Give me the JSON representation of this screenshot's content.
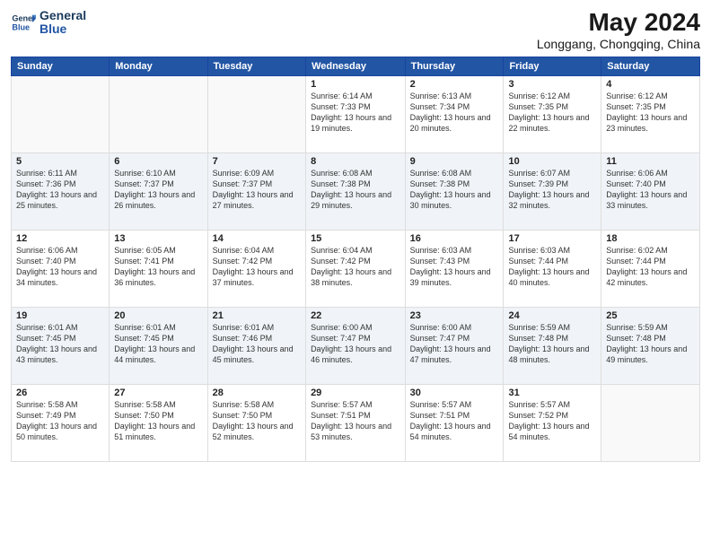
{
  "header": {
    "logo_line1": "General",
    "logo_line2": "Blue",
    "title": "May 2024",
    "subtitle": "Longgang, Chongqing, China"
  },
  "weekdays": [
    "Sunday",
    "Monday",
    "Tuesday",
    "Wednesday",
    "Thursday",
    "Friday",
    "Saturday"
  ],
  "weeks": [
    [
      {
        "day": "",
        "info": ""
      },
      {
        "day": "",
        "info": ""
      },
      {
        "day": "",
        "info": ""
      },
      {
        "day": "1",
        "info": "Sunrise: 6:14 AM\nSunset: 7:33 PM\nDaylight: 13 hours\nand 19 minutes."
      },
      {
        "day": "2",
        "info": "Sunrise: 6:13 AM\nSunset: 7:34 PM\nDaylight: 13 hours\nand 20 minutes."
      },
      {
        "day": "3",
        "info": "Sunrise: 6:12 AM\nSunset: 7:35 PM\nDaylight: 13 hours\nand 22 minutes."
      },
      {
        "day": "4",
        "info": "Sunrise: 6:12 AM\nSunset: 7:35 PM\nDaylight: 13 hours\nand 23 minutes."
      }
    ],
    [
      {
        "day": "5",
        "info": "Sunrise: 6:11 AM\nSunset: 7:36 PM\nDaylight: 13 hours\nand 25 minutes."
      },
      {
        "day": "6",
        "info": "Sunrise: 6:10 AM\nSunset: 7:37 PM\nDaylight: 13 hours\nand 26 minutes."
      },
      {
        "day": "7",
        "info": "Sunrise: 6:09 AM\nSunset: 7:37 PM\nDaylight: 13 hours\nand 27 minutes."
      },
      {
        "day": "8",
        "info": "Sunrise: 6:08 AM\nSunset: 7:38 PM\nDaylight: 13 hours\nand 29 minutes."
      },
      {
        "day": "9",
        "info": "Sunrise: 6:08 AM\nSunset: 7:38 PM\nDaylight: 13 hours\nand 30 minutes."
      },
      {
        "day": "10",
        "info": "Sunrise: 6:07 AM\nSunset: 7:39 PM\nDaylight: 13 hours\nand 32 minutes."
      },
      {
        "day": "11",
        "info": "Sunrise: 6:06 AM\nSunset: 7:40 PM\nDaylight: 13 hours\nand 33 minutes."
      }
    ],
    [
      {
        "day": "12",
        "info": "Sunrise: 6:06 AM\nSunset: 7:40 PM\nDaylight: 13 hours\nand 34 minutes."
      },
      {
        "day": "13",
        "info": "Sunrise: 6:05 AM\nSunset: 7:41 PM\nDaylight: 13 hours\nand 36 minutes."
      },
      {
        "day": "14",
        "info": "Sunrise: 6:04 AM\nSunset: 7:42 PM\nDaylight: 13 hours\nand 37 minutes."
      },
      {
        "day": "15",
        "info": "Sunrise: 6:04 AM\nSunset: 7:42 PM\nDaylight: 13 hours\nand 38 minutes."
      },
      {
        "day": "16",
        "info": "Sunrise: 6:03 AM\nSunset: 7:43 PM\nDaylight: 13 hours\nand 39 minutes."
      },
      {
        "day": "17",
        "info": "Sunrise: 6:03 AM\nSunset: 7:44 PM\nDaylight: 13 hours\nand 40 minutes."
      },
      {
        "day": "18",
        "info": "Sunrise: 6:02 AM\nSunset: 7:44 PM\nDaylight: 13 hours\nand 42 minutes."
      }
    ],
    [
      {
        "day": "19",
        "info": "Sunrise: 6:01 AM\nSunset: 7:45 PM\nDaylight: 13 hours\nand 43 minutes."
      },
      {
        "day": "20",
        "info": "Sunrise: 6:01 AM\nSunset: 7:45 PM\nDaylight: 13 hours\nand 44 minutes."
      },
      {
        "day": "21",
        "info": "Sunrise: 6:01 AM\nSunset: 7:46 PM\nDaylight: 13 hours\nand 45 minutes."
      },
      {
        "day": "22",
        "info": "Sunrise: 6:00 AM\nSunset: 7:47 PM\nDaylight: 13 hours\nand 46 minutes."
      },
      {
        "day": "23",
        "info": "Sunrise: 6:00 AM\nSunset: 7:47 PM\nDaylight: 13 hours\nand 47 minutes."
      },
      {
        "day": "24",
        "info": "Sunrise: 5:59 AM\nSunset: 7:48 PM\nDaylight: 13 hours\nand 48 minutes."
      },
      {
        "day": "25",
        "info": "Sunrise: 5:59 AM\nSunset: 7:48 PM\nDaylight: 13 hours\nand 49 minutes."
      }
    ],
    [
      {
        "day": "26",
        "info": "Sunrise: 5:58 AM\nSunset: 7:49 PM\nDaylight: 13 hours\nand 50 minutes."
      },
      {
        "day": "27",
        "info": "Sunrise: 5:58 AM\nSunset: 7:50 PM\nDaylight: 13 hours\nand 51 minutes."
      },
      {
        "day": "28",
        "info": "Sunrise: 5:58 AM\nSunset: 7:50 PM\nDaylight: 13 hours\nand 52 minutes."
      },
      {
        "day": "29",
        "info": "Sunrise: 5:57 AM\nSunset: 7:51 PM\nDaylight: 13 hours\nand 53 minutes."
      },
      {
        "day": "30",
        "info": "Sunrise: 5:57 AM\nSunset: 7:51 PM\nDaylight: 13 hours\nand 54 minutes."
      },
      {
        "day": "31",
        "info": "Sunrise: 5:57 AM\nSunset: 7:52 PM\nDaylight: 13 hours\nand 54 minutes."
      },
      {
        "day": "",
        "info": ""
      }
    ]
  ]
}
